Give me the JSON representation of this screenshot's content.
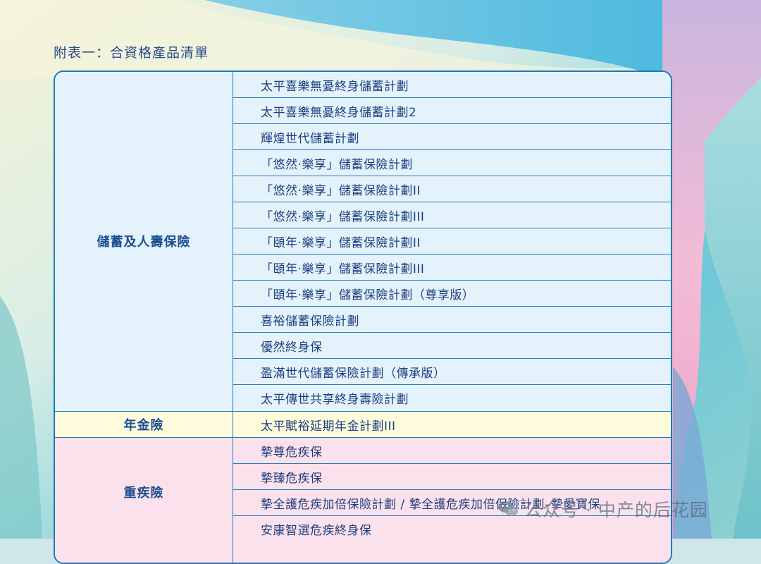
{
  "title": "附表一：合資格產品清單",
  "table": {
    "groups": [
      {
        "category": "儲蓄及人壽保險",
        "items": [
          "太平喜樂無憂終身儲蓄計劃",
          "太平喜樂無憂終身儲蓄計劃2",
          "輝煌世代儲蓄計劃",
          "「悠然‧樂享」儲蓄保險計劃",
          "「悠然‧樂享」儲蓄保險計劃II",
          "「悠然‧樂享」儲蓄保險計劃III",
          "「頤年‧樂享」儲蓄保險計劃II",
          "「頤年‧樂享」儲蓄保險計劃III",
          "「頤年‧樂享」儲蓄保險計劃（尊享版）",
          "喜裕儲蓄保險計劃",
          "優然終身保",
          "盈滿世代儲蓄保險計劃（傳承版）",
          "太平傳世共享終身壽險計劃"
        ]
      },
      {
        "category": "年金險",
        "items": [
          "太平賦裕延期年金計劃III"
        ]
      },
      {
        "category": "重疾險",
        "items": [
          "摯尊危疾保",
          "摯臻危疾保",
          "摯全護危疾加倍保險計劃 / 摯全護危疾加倍保險計劃–摯愛寶保",
          "安康智選危疾終身保"
        ]
      }
    ]
  },
  "watermark": {
    "text": "公众号 · 中产的后花园",
    "icon": "wechat-icon"
  },
  "colors": {
    "border": "#2278b8",
    "text": "#1e3f80",
    "savings_bg": "#e3f2fb",
    "annuity_bg": "#fdfbdc",
    "critical_bg": "#fbe1ec"
  }
}
